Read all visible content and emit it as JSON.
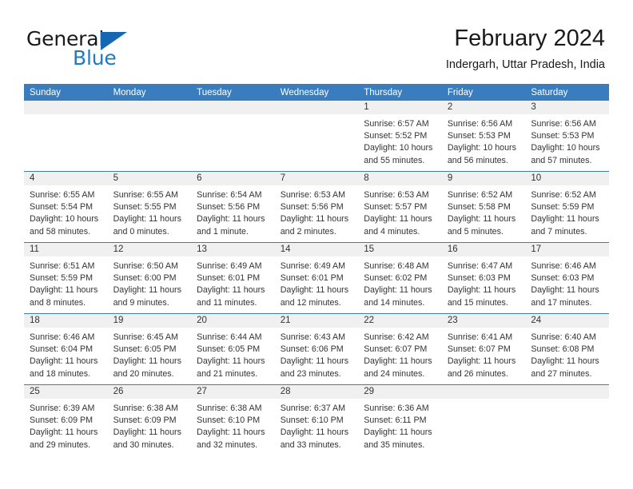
{
  "brand": {
    "name_top": "General",
    "name_bottom": "Blue",
    "accent_color": "#1f7ac4",
    "triangle_color": "#1567b3"
  },
  "header": {
    "title": "February 2024",
    "subtitle": "Indergarh, Uttar Pradesh, India"
  },
  "theme": {
    "header_bg": "#3a7dbe",
    "header_text": "#ffffff",
    "daynum_bg": "#f0f0f0",
    "cell_bg": "#ffffff",
    "grid_line": "#3a7dbe"
  },
  "weekday_headers": [
    "Sunday",
    "Monday",
    "Tuesday",
    "Wednesday",
    "Thursday",
    "Friday",
    "Saturday"
  ],
  "weeks": [
    [
      {
        "day": "",
        "sunrise": "",
        "sunset": "",
        "daylight1": "",
        "daylight2": "",
        "empty": true
      },
      {
        "day": "",
        "sunrise": "",
        "sunset": "",
        "daylight1": "",
        "daylight2": "",
        "empty": true
      },
      {
        "day": "",
        "sunrise": "",
        "sunset": "",
        "daylight1": "",
        "daylight2": "",
        "empty": true
      },
      {
        "day": "",
        "sunrise": "",
        "sunset": "",
        "daylight1": "",
        "daylight2": "",
        "empty": true
      },
      {
        "day": "1",
        "sunrise": "Sunrise: 6:57 AM",
        "sunset": "Sunset: 5:52 PM",
        "daylight1": "Daylight: 10 hours",
        "daylight2": "and 55 minutes.",
        "empty": false
      },
      {
        "day": "2",
        "sunrise": "Sunrise: 6:56 AM",
        "sunset": "Sunset: 5:53 PM",
        "daylight1": "Daylight: 10 hours",
        "daylight2": "and 56 minutes.",
        "empty": false
      },
      {
        "day": "3",
        "sunrise": "Sunrise: 6:56 AM",
        "sunset": "Sunset: 5:53 PM",
        "daylight1": "Daylight: 10 hours",
        "daylight2": "and 57 minutes.",
        "empty": false
      }
    ],
    [
      {
        "day": "4",
        "sunrise": "Sunrise: 6:55 AM",
        "sunset": "Sunset: 5:54 PM",
        "daylight1": "Daylight: 10 hours",
        "daylight2": "and 58 minutes.",
        "empty": false
      },
      {
        "day": "5",
        "sunrise": "Sunrise: 6:55 AM",
        "sunset": "Sunset: 5:55 PM",
        "daylight1": "Daylight: 11 hours",
        "daylight2": "and 0 minutes.",
        "empty": false
      },
      {
        "day": "6",
        "sunrise": "Sunrise: 6:54 AM",
        "sunset": "Sunset: 5:56 PM",
        "daylight1": "Daylight: 11 hours",
        "daylight2": "and 1 minute.",
        "empty": false
      },
      {
        "day": "7",
        "sunrise": "Sunrise: 6:53 AM",
        "sunset": "Sunset: 5:56 PM",
        "daylight1": "Daylight: 11 hours",
        "daylight2": "and 2 minutes.",
        "empty": false
      },
      {
        "day": "8",
        "sunrise": "Sunrise: 6:53 AM",
        "sunset": "Sunset: 5:57 PM",
        "daylight1": "Daylight: 11 hours",
        "daylight2": "and 4 minutes.",
        "empty": false
      },
      {
        "day": "9",
        "sunrise": "Sunrise: 6:52 AM",
        "sunset": "Sunset: 5:58 PM",
        "daylight1": "Daylight: 11 hours",
        "daylight2": "and 5 minutes.",
        "empty": false
      },
      {
        "day": "10",
        "sunrise": "Sunrise: 6:52 AM",
        "sunset": "Sunset: 5:59 PM",
        "daylight1": "Daylight: 11 hours",
        "daylight2": "and 7 minutes.",
        "empty": false
      }
    ],
    [
      {
        "day": "11",
        "sunrise": "Sunrise: 6:51 AM",
        "sunset": "Sunset: 5:59 PM",
        "daylight1": "Daylight: 11 hours",
        "daylight2": "and 8 minutes.",
        "empty": false
      },
      {
        "day": "12",
        "sunrise": "Sunrise: 6:50 AM",
        "sunset": "Sunset: 6:00 PM",
        "daylight1": "Daylight: 11 hours",
        "daylight2": "and 9 minutes.",
        "empty": false
      },
      {
        "day": "13",
        "sunrise": "Sunrise: 6:49 AM",
        "sunset": "Sunset: 6:01 PM",
        "daylight1": "Daylight: 11 hours",
        "daylight2": "and 11 minutes.",
        "empty": false
      },
      {
        "day": "14",
        "sunrise": "Sunrise: 6:49 AM",
        "sunset": "Sunset: 6:01 PM",
        "daylight1": "Daylight: 11 hours",
        "daylight2": "and 12 minutes.",
        "empty": false
      },
      {
        "day": "15",
        "sunrise": "Sunrise: 6:48 AM",
        "sunset": "Sunset: 6:02 PM",
        "daylight1": "Daylight: 11 hours",
        "daylight2": "and 14 minutes.",
        "empty": false
      },
      {
        "day": "16",
        "sunrise": "Sunrise: 6:47 AM",
        "sunset": "Sunset: 6:03 PM",
        "daylight1": "Daylight: 11 hours",
        "daylight2": "and 15 minutes.",
        "empty": false
      },
      {
        "day": "17",
        "sunrise": "Sunrise: 6:46 AM",
        "sunset": "Sunset: 6:03 PM",
        "daylight1": "Daylight: 11 hours",
        "daylight2": "and 17 minutes.",
        "empty": false
      }
    ],
    [
      {
        "day": "18",
        "sunrise": "Sunrise: 6:46 AM",
        "sunset": "Sunset: 6:04 PM",
        "daylight1": "Daylight: 11 hours",
        "daylight2": "and 18 minutes.",
        "empty": false
      },
      {
        "day": "19",
        "sunrise": "Sunrise: 6:45 AM",
        "sunset": "Sunset: 6:05 PM",
        "daylight1": "Daylight: 11 hours",
        "daylight2": "and 20 minutes.",
        "empty": false
      },
      {
        "day": "20",
        "sunrise": "Sunrise: 6:44 AM",
        "sunset": "Sunset: 6:05 PM",
        "daylight1": "Daylight: 11 hours",
        "daylight2": "and 21 minutes.",
        "empty": false
      },
      {
        "day": "21",
        "sunrise": "Sunrise: 6:43 AM",
        "sunset": "Sunset: 6:06 PM",
        "daylight1": "Daylight: 11 hours",
        "daylight2": "and 23 minutes.",
        "empty": false
      },
      {
        "day": "22",
        "sunrise": "Sunrise: 6:42 AM",
        "sunset": "Sunset: 6:07 PM",
        "daylight1": "Daylight: 11 hours",
        "daylight2": "and 24 minutes.",
        "empty": false
      },
      {
        "day": "23",
        "sunrise": "Sunrise: 6:41 AM",
        "sunset": "Sunset: 6:07 PM",
        "daylight1": "Daylight: 11 hours",
        "daylight2": "and 26 minutes.",
        "empty": false
      },
      {
        "day": "24",
        "sunrise": "Sunrise: 6:40 AM",
        "sunset": "Sunset: 6:08 PM",
        "daylight1": "Daylight: 11 hours",
        "daylight2": "and 27 minutes.",
        "empty": false
      }
    ],
    [
      {
        "day": "25",
        "sunrise": "Sunrise: 6:39 AM",
        "sunset": "Sunset: 6:09 PM",
        "daylight1": "Daylight: 11 hours",
        "daylight2": "and 29 minutes.",
        "empty": false
      },
      {
        "day": "26",
        "sunrise": "Sunrise: 6:38 AM",
        "sunset": "Sunset: 6:09 PM",
        "daylight1": "Daylight: 11 hours",
        "daylight2": "and 30 minutes.",
        "empty": false
      },
      {
        "day": "27",
        "sunrise": "Sunrise: 6:38 AM",
        "sunset": "Sunset: 6:10 PM",
        "daylight1": "Daylight: 11 hours",
        "daylight2": "and 32 minutes.",
        "empty": false
      },
      {
        "day": "28",
        "sunrise": "Sunrise: 6:37 AM",
        "sunset": "Sunset: 6:10 PM",
        "daylight1": "Daylight: 11 hours",
        "daylight2": "and 33 minutes.",
        "empty": false
      },
      {
        "day": "29",
        "sunrise": "Sunrise: 6:36 AM",
        "sunset": "Sunset: 6:11 PM",
        "daylight1": "Daylight: 11 hours",
        "daylight2": "and 35 minutes.",
        "empty": false
      },
      {
        "day": "",
        "sunrise": "",
        "sunset": "",
        "daylight1": "",
        "daylight2": "",
        "empty": true
      },
      {
        "day": "",
        "sunrise": "",
        "sunset": "",
        "daylight1": "",
        "daylight2": "",
        "empty": true
      }
    ]
  ]
}
